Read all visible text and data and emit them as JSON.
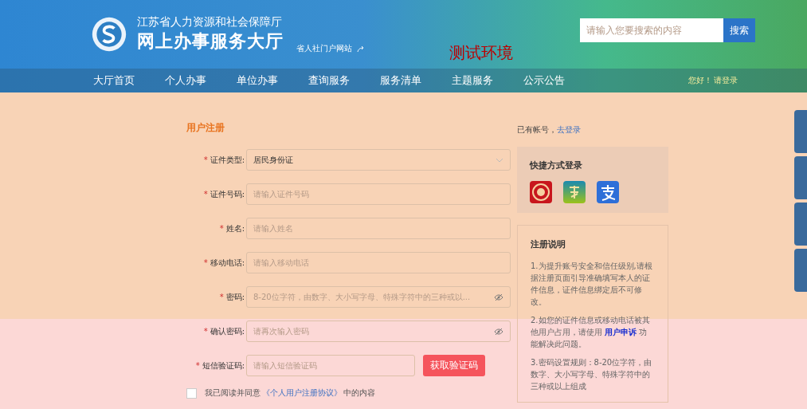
{
  "header": {
    "org": "江苏省人力资源和社会保障厅",
    "title": "网上办事服务大厅",
    "portal_link": "省人社门户网站",
    "env_label": "测试环境",
    "search": {
      "placeholder": "请输入您要搜索的内容",
      "button": "搜索"
    }
  },
  "nav": {
    "items": [
      {
        "label": "大厅首页",
        "selected": false
      },
      {
        "label": "个人办事",
        "selected": false
      },
      {
        "label": "单位办事",
        "selected": false
      },
      {
        "label": "查询服务",
        "selected": false
      },
      {
        "label": "服务清单",
        "selected": false
      },
      {
        "label": "主题服务",
        "selected": false
      },
      {
        "label": "公示公告",
        "selected": false
      }
    ],
    "greeting": "您好！",
    "login": "请登录"
  },
  "form": {
    "title": "用户注册",
    "fields": [
      {
        "required_mark": "*",
        "label": "证件类型:",
        "kind": "select",
        "value": "居民身份证"
      },
      {
        "required_mark": "*",
        "label": "证件号码:",
        "kind": "text",
        "placeholder": "请输入证件号码"
      },
      {
        "required_mark": "*",
        "label": "姓名:",
        "kind": "text",
        "placeholder": "请输入姓名"
      },
      {
        "required_mark": "*",
        "label": "移动电话:",
        "kind": "text",
        "placeholder": "请输入移动电话"
      },
      {
        "required_mark": "*",
        "label": "密码:",
        "kind": "password",
        "placeholder": "8-20位字符，由数字、大小写字母、特殊字符中的三种或以..."
      },
      {
        "required_mark": "*",
        "label": "确认密码:",
        "kind": "password",
        "placeholder": "请再次输入密码"
      },
      {
        "required_mark": "*",
        "label": "短信验证码:",
        "kind": "sms",
        "placeholder": "请输入短信验证码",
        "button": "获取验证码"
      }
    ],
    "agreement": {
      "checked": false,
      "before": "我已阅读并同意",
      "link": "《个人用户注册协议》",
      "after": "中的内容"
    }
  },
  "side": {
    "has_account": "已有帐号，",
    "login_link": "去登录",
    "quick_login": {
      "title": "快捷方式登录"
    },
    "notes": {
      "title": "注册说明",
      "items": [
        "1.为提升账号安全和信任级别,请根据注册页面引导准确填写本人的证件信息，证件信息绑定后不可修改。",
        "2.如您的证件信息或移动电话被其他用户占用，请使用 **用户申诉** 功能解决此问题。",
        "3.密码设置规则：8-20位字符，由数字、大小写字母、特殊字符中的三种或以上组成"
      ]
    }
  }
}
